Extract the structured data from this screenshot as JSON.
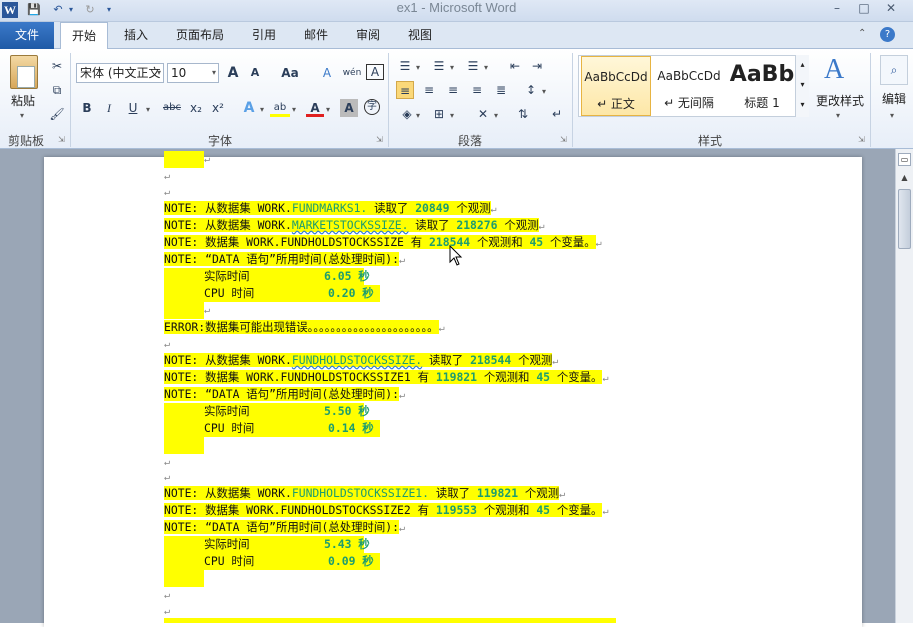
{
  "app": {
    "window_title": "ex1 - Microsoft Word",
    "window_controls": {
      "minimize": "–",
      "maximize": "□",
      "close": "✕"
    },
    "quick_access": {
      "logo": "W",
      "save": "💾",
      "undo": "↶",
      "undo_more": "▾",
      "redo": "↻",
      "customize": "▾"
    }
  },
  "tabs": [
    {
      "label": "文件"
    },
    {
      "label": "开始"
    },
    {
      "label": "插入"
    },
    {
      "label": "页面布局"
    },
    {
      "label": "引用"
    },
    {
      "label": "邮件"
    },
    {
      "label": "审阅"
    },
    {
      "label": "视图"
    }
  ],
  "ribbon": {
    "clipboard": {
      "group": "剪贴板",
      "paste": "粘贴",
      "cut": "✂",
      "copy": "⧉",
      "format_painter": "🖌"
    },
    "font": {
      "group": "字体",
      "font_name": "宋体 (中文正文",
      "font_size": "10",
      "grow": "A",
      "shrink": "A",
      "change_case": "Aa",
      "clear_format": "A",
      "phonetic": "wén",
      "char_border": "A",
      "bold": "B",
      "italic": "I",
      "underline": "U",
      "strikethrough": "abc",
      "subscript": "x₂",
      "superscript": "x²",
      "text_effect": "A",
      "highlight": "ab",
      "font_color": "A",
      "char_shading": "A",
      "enclose": "字"
    },
    "paragraph": {
      "group": "段落"
    },
    "styles": {
      "group": "样式",
      "items": [
        {
          "sample": "AaBbCcDd",
          "name": "↵ 正文"
        },
        {
          "sample": "AaBbCcDd",
          "name": "↵ 无间隔"
        },
        {
          "sample": "AaBb",
          "name": "标题 1"
        }
      ],
      "change_styles": "更改样式"
    },
    "editing": {
      "label": "编辑"
    }
  },
  "document": {
    "lines": [
      "NOTE: 从数据集 WORK.FUNDMARKS1. 读取了 20849 个观测",
      "NOTE: 从数据集 WORK.MARKETSTOCKSSIZE. 读取了 218276 个观测",
      "NOTE: 数据集 WORK.FUNDHOLDSTOCKSSIZE 有 218544 个观测和 45 个变量。",
      "NOTE: “DATA 语句”所用时间(总处理时间):",
      "实际时间",
      "6.05 秒",
      "CPU 时间",
      "0.20 秒",
      "ERROR:数据集可能出现错误。。。。。。。。。。。。。。。。。。。。。。",
      "NOTE: 从数据集 WORK.FUNDHOLDSTOCKSSIZE. 读取了 218544 个观测",
      "NOTE: 数据集 WORK.FUNDHOLDSTOCKSSIZE1 有 119821 个观测和 45 个变量。",
      "NOTE: “DATA 语句”所用时间(总处理时间):",
      "实际时间",
      "5.50 秒",
      "CPU 时间",
      "0.14 秒",
      "NOTE: 从数据集 WORK.FUNDHOLDSTOCKSSIZE1. 读取了 119821 个观测",
      "NOTE: 数据集 WORK.FUNDHOLDSTOCKSSIZE2 有 119553 个观测和 45 个变量。",
      "NOTE: “DATA 语句”所用时间(总处理时间):",
      "实际时间",
      "5.43 秒",
      "CPU 时间",
      "0.09 秒"
    ],
    "paragraph_mark": "↵"
  },
  "colors": {
    "highlight": "#ffff00",
    "number": "#1d9d6e",
    "file_tab": "#2b579a"
  }
}
